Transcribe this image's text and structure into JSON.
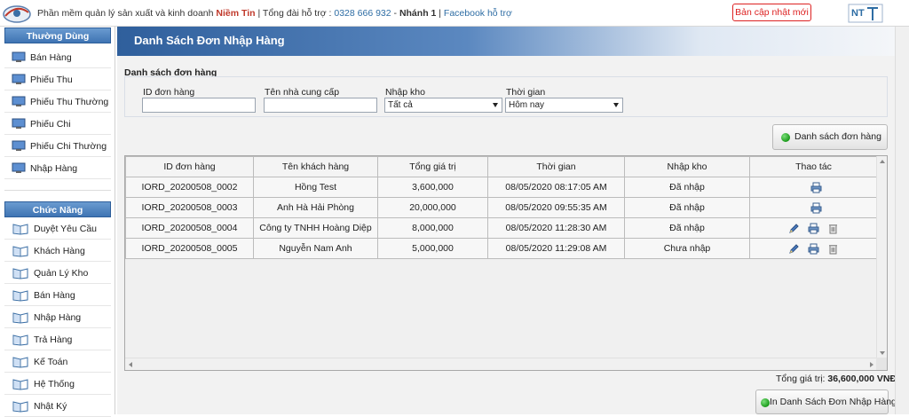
{
  "topbar": {
    "prefix": "Phần mềm quản lý sản xuất và kinh doanh ",
    "brand": "Niềm Tin",
    "sep1": " | Tổng đài hỗ trợ : ",
    "phone": "0328 666 932",
    "sep2": " - ",
    "branch": "Nhánh 1",
    "sep3": " | ",
    "facebook": "Facebook hỗ trợ",
    "update_button": "Bản cập nhật mới",
    "brand_logo_text": "NT"
  },
  "sidebar": {
    "common_title": "Thường Dùng",
    "common_items": [
      {
        "label": "Bán Hàng"
      },
      {
        "label": "Phiếu Thu"
      },
      {
        "label": "Phiếu Thu Thường"
      },
      {
        "label": "Phiếu Chi"
      },
      {
        "label": "Phiếu Chi Thường"
      },
      {
        "label": "Nhập Hàng"
      }
    ],
    "function_title": "Chức Năng",
    "function_items": [
      {
        "label": "Duyệt Yêu Cầu"
      },
      {
        "label": "Khách Hàng"
      },
      {
        "label": "Quản Lý Kho"
      },
      {
        "label": "Bán Hàng"
      },
      {
        "label": "Nhập Hàng"
      },
      {
        "label": "Trả Hàng"
      },
      {
        "label": "Kế Toán"
      },
      {
        "label": "Hệ Thống"
      },
      {
        "label": "Nhật Ký"
      }
    ]
  },
  "main": {
    "title": "Danh Sách Đơn Nhập Hàng",
    "section_label": "Danh sách đơn hàng",
    "filters": {
      "order_id_label": "ID đơn hàng",
      "order_id_value": "",
      "supplier_label": "Tên nhà cung cấp",
      "supplier_value": "",
      "import_label": "Nhập kho",
      "import_value": "Tất cả",
      "time_label": "Thời gian",
      "time_value": "Hôm nay"
    },
    "list_button": "Danh sách đơn hàng",
    "table": {
      "headers": [
        "ID đơn hàng",
        "Tên khách hàng",
        "Tổng giá trị",
        "Thời gian",
        "Nhập kho",
        "Thao tác"
      ],
      "rows": [
        {
          "id": "IORD_20200508_0002",
          "customer": "Hồng Test",
          "total": "3,600,000",
          "time": "08/05/2020 08:17:05 AM",
          "status": "Đã nhập",
          "actions": [
            "print"
          ]
        },
        {
          "id": "IORD_20200508_0003",
          "customer": "Anh Hà Hải Phòng",
          "total": "20,000,000",
          "time": "08/05/2020 09:55:35 AM",
          "status": "Đã nhập",
          "actions": [
            "print"
          ]
        },
        {
          "id": "IORD_20200508_0004",
          "customer": "Công ty TNHH Hoàng Diệp",
          "total": "8,000,000",
          "time": "08/05/2020 11:28:30 AM",
          "status": "Đã nhập",
          "actions": [
            "edit",
            "print",
            "delete"
          ]
        },
        {
          "id": "IORD_20200508_0005",
          "customer": "Nguyễn Nam Anh",
          "total": "5,000,000",
          "time": "08/05/2020 11:29:08 AM",
          "status": "Chưa nhập",
          "actions": [
            "edit",
            "print",
            "delete"
          ]
        }
      ]
    },
    "total_label": "Tổng giá trị: ",
    "total_value": "36,600,000 VNĐ",
    "print_button": "In Danh Sách Đơn Nhập Hàng"
  }
}
